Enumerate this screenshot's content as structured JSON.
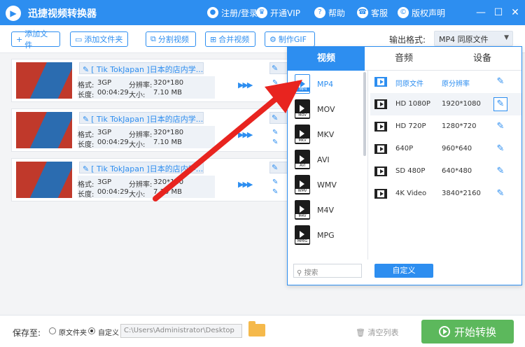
{
  "app": {
    "title": "迅捷视频转换器"
  },
  "header": {
    "login": "注册/登录",
    "vip": "开通VIP",
    "help": "帮助",
    "service": "客服",
    "copyright": "版权声明"
  },
  "toolbar": {
    "add_file": "添加文件",
    "add_folder": "添加文件夹",
    "split": "分割视频",
    "merge": "合并视频",
    "gif": "制作GIF",
    "output_label": "输出格式:",
    "output_value": "MP4 同原文件"
  },
  "videos": [
    {
      "name": "[ Tik TokJapan ]日本的店内学...",
      "format_k": "格式:",
      "format": "3GP",
      "res_k": "分辨率:",
      "res": "320*180",
      "dur_k": "长度:",
      "dur": "00:04:29",
      "size_k": "大小:",
      "size": "7.10 MB"
    },
    {
      "name": "[ Tik TokJapan ]日本的店内学...",
      "format_k": "格式:",
      "format": "3GP",
      "res_k": "分辨率:",
      "res": "320*180",
      "dur_k": "长度:",
      "dur": "00:04:29",
      "size_k": "大小:",
      "size": "7.10 MB"
    },
    {
      "name": "[ Tik TokJapan ]日本的店内学...",
      "format_k": "格式:",
      "format": "3GP",
      "res_k": "分辨率:",
      "res": "320*180",
      "dur_k": "长度:",
      "dur": "00:04:29",
      "size_k": "大小:",
      "size": "7.10 MB"
    }
  ],
  "panel": {
    "tabs": [
      "视频",
      "音频",
      "设备"
    ],
    "formats": [
      {
        "label": "MP4",
        "tag": "MP4"
      },
      {
        "label": "MOV",
        "tag": "MOV"
      },
      {
        "label": "MKV",
        "tag": "MKV"
      },
      {
        "label": "AVI",
        "tag": "AVI"
      },
      {
        "label": "WMV",
        "tag": "WMV"
      },
      {
        "label": "M4V",
        "tag": "M4V"
      },
      {
        "label": "MPG",
        "tag": "MPEG"
      }
    ],
    "resolutions": [
      {
        "name": "同原文件",
        "res": "原分辨率"
      },
      {
        "name": "HD 1080P",
        "res": "1920*1080"
      },
      {
        "name": "HD 720P",
        "res": "1280*720"
      },
      {
        "name": "640P",
        "res": "960*640"
      },
      {
        "name": "SD 480P",
        "res": "640*480"
      },
      {
        "name": "4K Video",
        "res": "3840*2160"
      }
    ],
    "search_placeholder": "搜索",
    "custom": "自定义"
  },
  "bottom": {
    "save_label": "保存至:",
    "opt_original": "原文件夹",
    "opt_custom": "自定义",
    "path": "C:\\Users\\Administrator\\Desktop",
    "clear": "清空列表",
    "start": "开始转换"
  },
  "colors": {
    "accent": "#2d8ef0",
    "start": "#5cb85c",
    "arrow": "#e8241f"
  }
}
